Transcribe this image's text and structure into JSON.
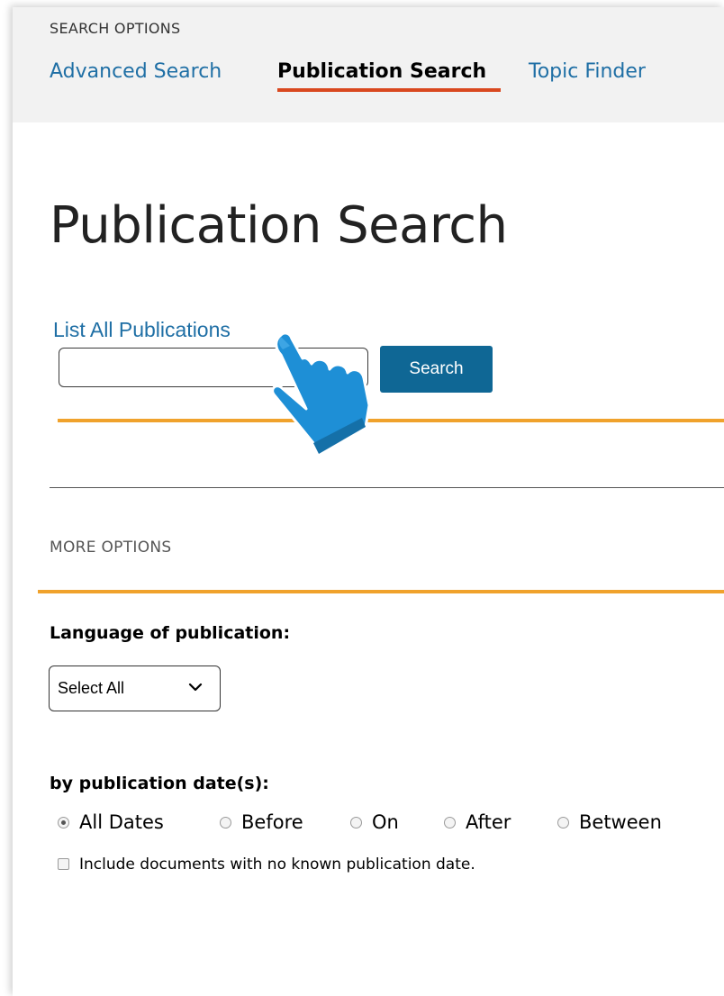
{
  "search_options": {
    "label": "SEARCH OPTIONS",
    "tabs": [
      {
        "label": "Advanced Search",
        "active": false
      },
      {
        "label": "Publication Search",
        "active": true
      },
      {
        "label": "Topic Finder",
        "active": false
      }
    ]
  },
  "main": {
    "title": "Publication Search",
    "list_all_link": "List All Publications",
    "search_input": {
      "value": "",
      "placeholder": ""
    },
    "search_button": "Search"
  },
  "more_options": {
    "label": "MORE OPTIONS",
    "language": {
      "label": "Language of publication:",
      "selected": "Select All"
    },
    "date": {
      "label": "by publication date(s):",
      "options": [
        {
          "label": "All Dates",
          "checked": true
        },
        {
          "label": "Before",
          "checked": false
        },
        {
          "label": "On",
          "checked": false
        },
        {
          "label": "After",
          "checked": false
        },
        {
          "label": "Between",
          "checked": false
        }
      ],
      "include_unknown": {
        "label": "Include documents with no known publication date.",
        "checked": false
      }
    }
  },
  "colors": {
    "link": "#1f6fa5",
    "accent_orange": "#f0a22c",
    "active_tab_underline": "#d9481f",
    "button_bg": "#0f6795",
    "header_bg": "#f2f2f2",
    "cursor": "#1e8fd6"
  },
  "icons": {
    "select_arrow": "chevron-down-icon",
    "cursor": "hand-pointer-icon"
  }
}
